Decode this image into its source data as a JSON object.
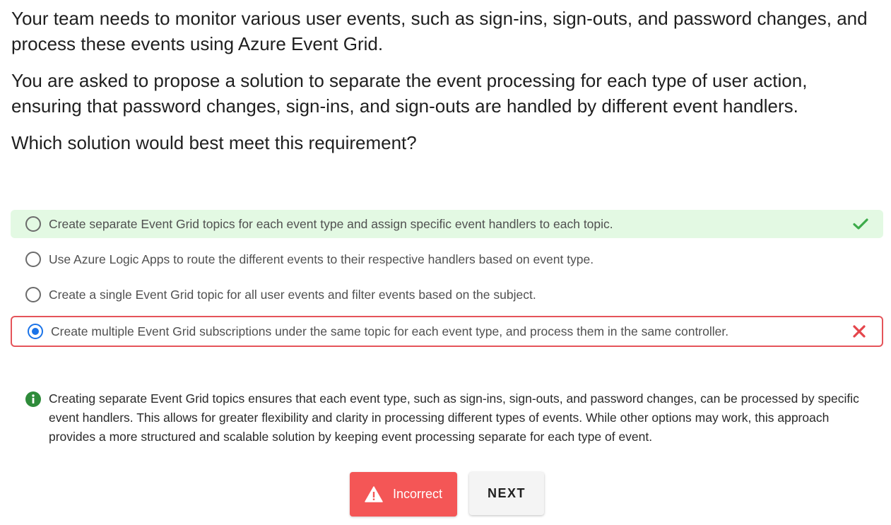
{
  "question": {
    "paragraphs": [
      "Your team needs to monitor various user events, such as sign-ins, sign-outs, and password changes, and process these events using Azure Event Grid.",
      "You are asked to propose a solution to separate the event processing for each type of user action, ensuring that password changes, sign-ins, and sign-outs are handled by different event handlers.",
      "Which solution would best meet this requirement?"
    ]
  },
  "options": [
    {
      "label": "Create separate Event Grid topics for each event type and assign specific event handlers to each topic.",
      "state": "correct",
      "mark_icon": "checkmark-icon"
    },
    {
      "label": "Use Azure Logic Apps to route the different events to their respective handlers based on event type.",
      "state": "neutral"
    },
    {
      "label": "Create a single Event Grid topic for all user events and filter events based on the subject.",
      "state": "neutral"
    },
    {
      "label": "Create multiple Event Grid subscriptions under the same topic for each event type, and process them in the same controller.",
      "state": "selected-incorrect",
      "mark_icon": "x-mark-icon"
    }
  ],
  "explanation": {
    "icon": "info-icon",
    "text": "Creating separate Event Grid topics ensures that each event type, such as sign-ins, sign-outs, and password changes, can be processed by specific event handlers. This allows for greater flexibility and clarity in processing different types of events. While other options may work, this approach provides a more structured and scalable solution by keeping event processing separate for each type of event."
  },
  "buttons": {
    "result_label": "Incorrect",
    "result_icon": "warning-icon",
    "next_label": "NEXT"
  },
  "colors": {
    "correct_bg": "#e3f9e3",
    "correct_mark": "#3cab4a",
    "incorrect_border": "#e5545a",
    "incorrect_mark": "#e5454b",
    "incorrect_button": "#f45656",
    "radio_selected": "#1a73e8",
    "info_icon": "#2e8b3a"
  }
}
